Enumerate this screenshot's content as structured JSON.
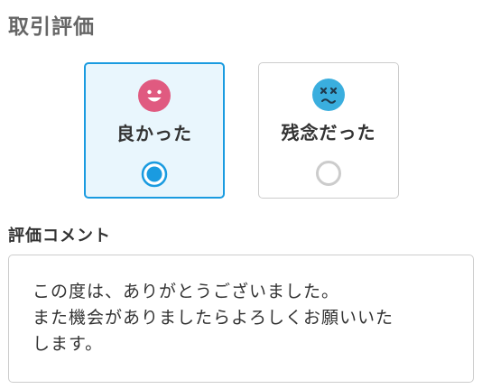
{
  "section_title": "取引評価",
  "ratings": {
    "good": {
      "label": "良かった",
      "icon": "smiling-face-icon",
      "selected": true,
      "color": "#e05a80"
    },
    "bad": {
      "label": "残念だった",
      "icon": "dizzy-face-icon",
      "selected": false,
      "color": "#3aaede"
    },
    "selected_color": "#1a9be0"
  },
  "comment": {
    "heading": "評価コメント",
    "value": "この度は、ありがとうございました。\nまた機会がありましたらよろしくお願いいた\nします。"
  }
}
